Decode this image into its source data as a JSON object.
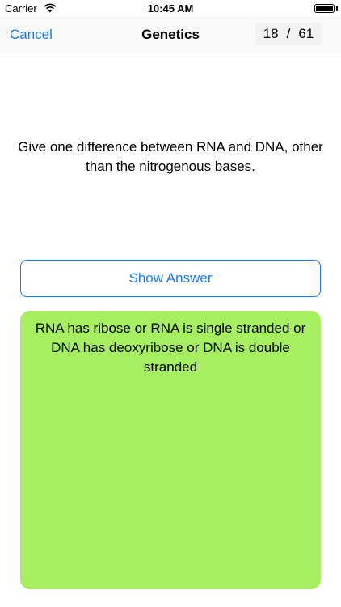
{
  "status_bar": {
    "carrier": "Carrier",
    "time": "10:45 AM",
    "wifi_icon": "wifi-icon",
    "battery_icon": "battery-icon"
  },
  "nav": {
    "cancel_label": "Cancel",
    "title": "Genetics",
    "current": "18",
    "separator": "/",
    "total": "61"
  },
  "card": {
    "question": "Give one difference between RNA and DNA, other than the nitrogenous bases.",
    "show_answer_label": "Show Answer",
    "answer": "RNA has ribose or RNA is single stranded or DNA has deoxyribose or DNA is double stranded"
  },
  "colors": {
    "accent": "#1a7cf5",
    "answer_background": "#a5ef60"
  }
}
